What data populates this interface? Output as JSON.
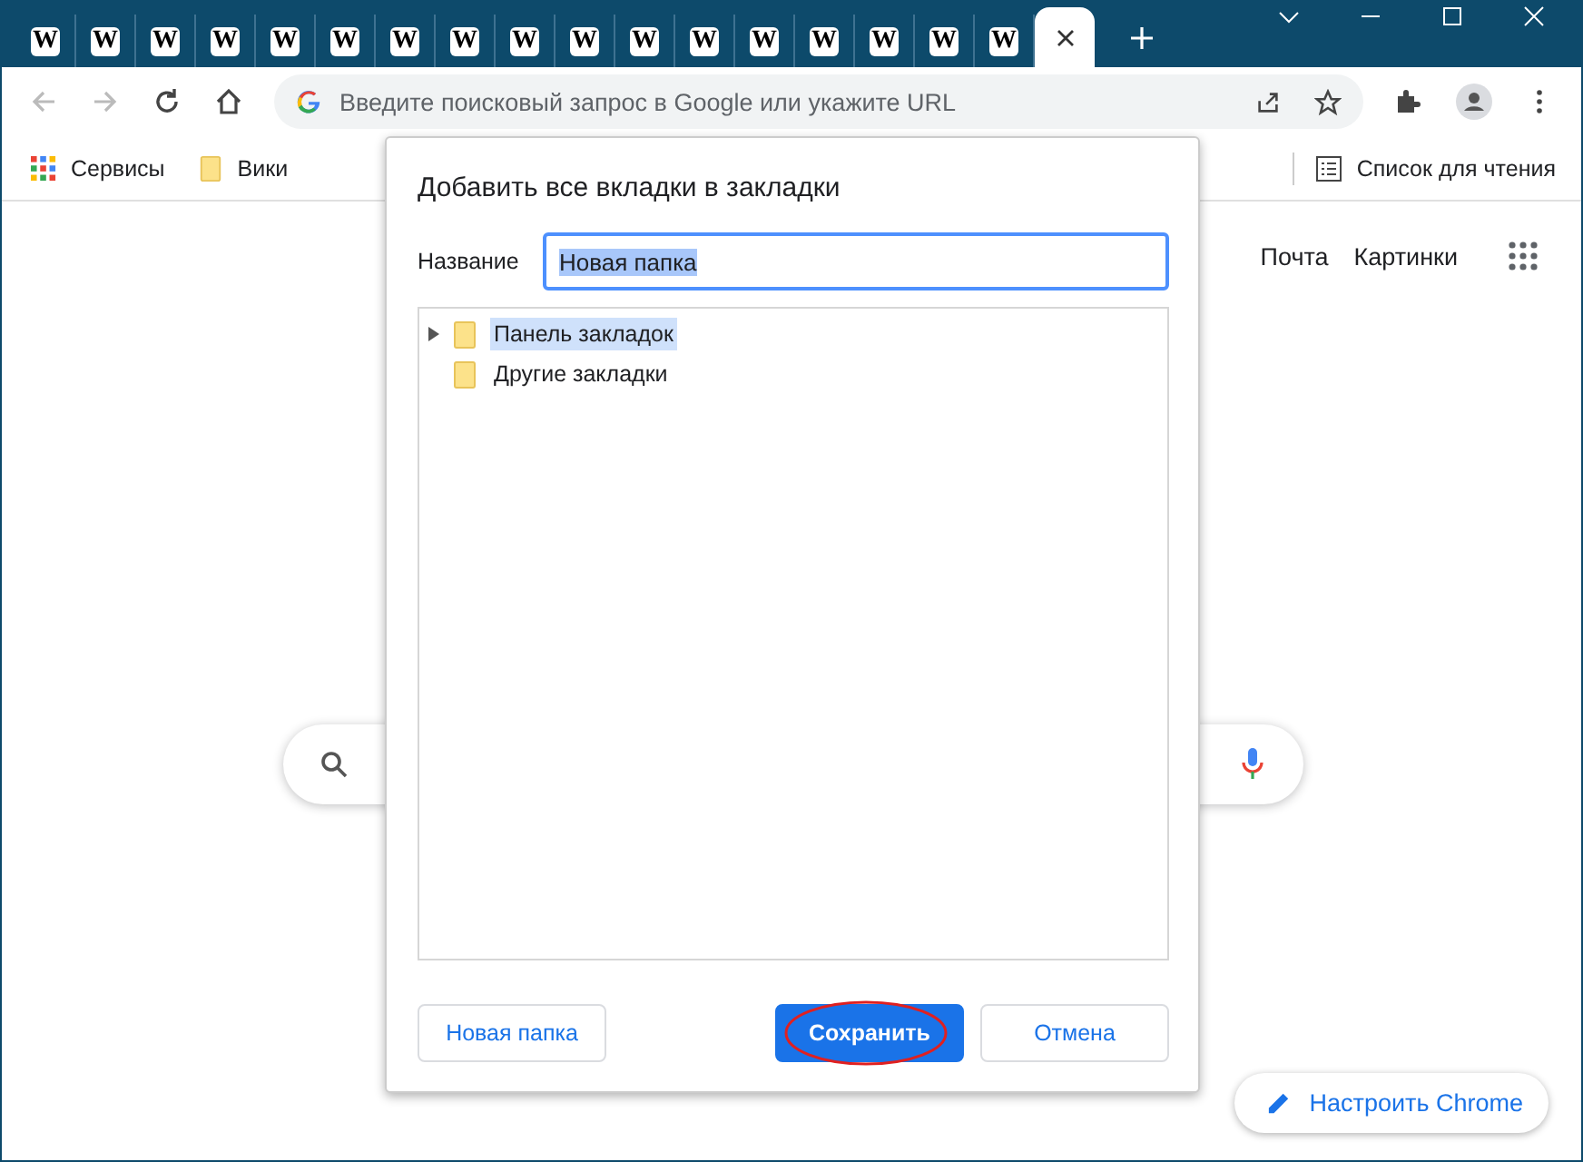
{
  "tabs": [
    {
      "favicon": "W",
      "selected": false
    },
    {
      "favicon": "W",
      "selected": false
    },
    {
      "favicon": "W",
      "selected": false
    },
    {
      "favicon": "W",
      "selected": false
    },
    {
      "favicon": "W",
      "selected": false
    },
    {
      "favicon": "W",
      "selected": false
    },
    {
      "favicon": "W",
      "selected": false
    },
    {
      "favicon": "W",
      "selected": false
    },
    {
      "favicon": "W",
      "selected": false
    },
    {
      "favicon": "W",
      "selected": false
    },
    {
      "favicon": "W",
      "selected": false
    },
    {
      "favicon": "W",
      "selected": false
    },
    {
      "favicon": "W",
      "selected": false
    },
    {
      "favicon": "W",
      "selected": false
    },
    {
      "favicon": "W",
      "selected": false
    },
    {
      "favicon": "W",
      "selected": false
    },
    {
      "favicon": "W",
      "selected": false
    },
    {
      "selected": true
    }
  ],
  "address_bar": {
    "placeholder": "Введите поисковый запрос в Google или укажите URL"
  },
  "bookmarks_bar": {
    "items": [
      {
        "label": "Сервисы",
        "kind": "apps"
      },
      {
        "label": "Вики",
        "kind": "folder"
      }
    ],
    "reading_list": "Список для чтения"
  },
  "page": {
    "links": [
      "Почта",
      "Картинки"
    ],
    "customize_button": "Настроить Chrome"
  },
  "dialog": {
    "title": "Добавить все вкладки в закладки",
    "name_label": "Название",
    "name_value": "Новая папка",
    "name_selected": true,
    "folders": [
      {
        "label": "Панель закладок",
        "expandable": true,
        "selected": true
      },
      {
        "label": "Другие закладки",
        "expandable": false,
        "selected": false
      }
    ],
    "buttons": [
      {
        "label": "Новая папка",
        "kind": "secondary",
        "annotated": false
      },
      {
        "label": "Сохранить",
        "kind": "primary",
        "annotated": true
      },
      {
        "label": "Отмена",
        "kind": "secondary",
        "annotated": false
      }
    ]
  }
}
